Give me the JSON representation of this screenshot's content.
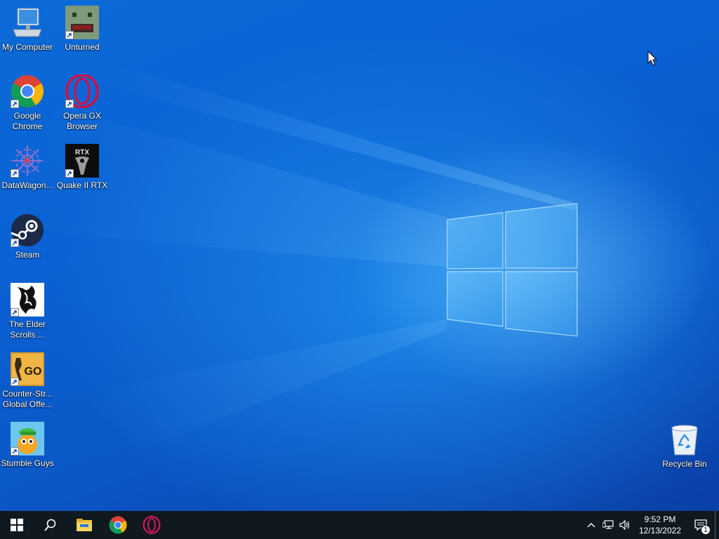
{
  "desktop_icons": [
    {
      "label": "My Computer",
      "icon": "computer-icon"
    },
    {
      "label": "Unturned",
      "icon": "unturned-icon"
    },
    {
      "label": "Google\nChrome",
      "icon": "chrome-icon"
    },
    {
      "label": "Opera GX\nBrowser",
      "icon": "opera-gx-icon"
    },
    {
      "label": "DataWagon...",
      "icon": "datawagon-icon"
    },
    {
      "label": "Quake II RTX",
      "icon": "quake-rtx-icon"
    },
    {
      "label": "Steam",
      "icon": "steam-icon"
    },
    {
      "label": "The Elder\nScrolls ...",
      "icon": "elder-scrolls-icon"
    },
    {
      "label": "Counter-Str...\nGlobal Offe...",
      "icon": "csgo-icon"
    },
    {
      "label": "Stumble Guys",
      "icon": "stumble-guys-icon"
    },
    {
      "label": "Recycle Bin",
      "icon": "recycle-bin-icon"
    }
  ],
  "icon_text": {
    "rtx": "RTX",
    "go": "GO"
  },
  "taskbar": {
    "pinned": [
      "start-icon",
      "search-icon",
      "file-explorer-icon",
      "chrome-icon",
      "opera-icon"
    ],
    "tray": [
      "chevron-up-icon",
      "network-icon",
      "volume-icon"
    ]
  },
  "clock": {
    "time": "9:52 PM",
    "date": "12/13/2022"
  },
  "notifications": {
    "count": "1"
  },
  "colors": {
    "taskbar": "#101820",
    "wallpaper_blue": "#0a62d4"
  }
}
